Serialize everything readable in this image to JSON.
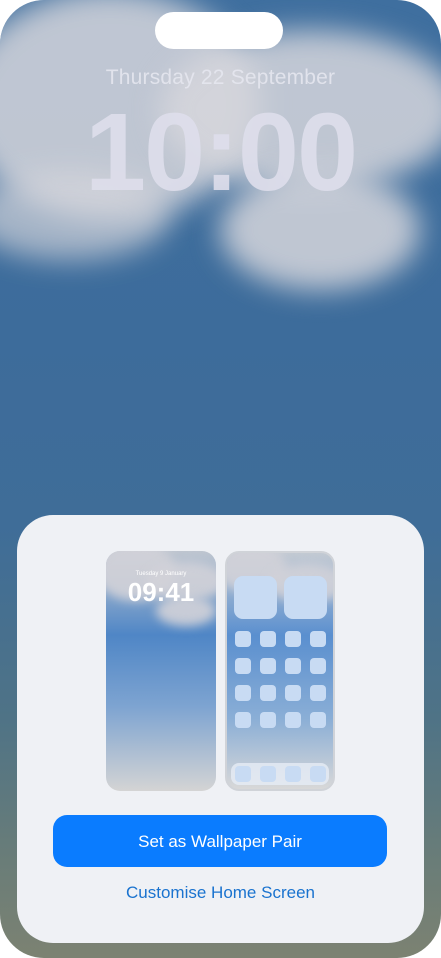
{
  "lock_screen": {
    "date": "Thursday 22 September",
    "time": "10:00"
  },
  "sheet": {
    "lock_preview": {
      "date": "Tuesday 9 January",
      "time": "09:41"
    },
    "primary_button_label": "Set as Wallpaper Pair",
    "secondary_link_label": "Customise Home Screen"
  },
  "colors": {
    "accent": "#0a7cff",
    "link": "#1a73cf",
    "sheet_background": "#eff1f5"
  }
}
